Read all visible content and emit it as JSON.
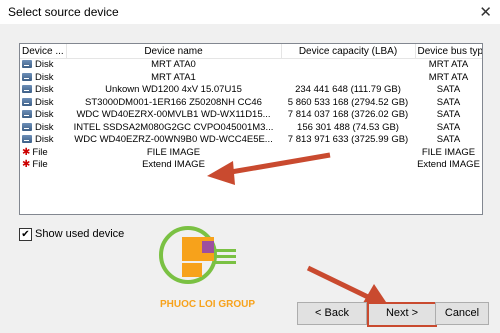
{
  "window": {
    "title": "Select source device",
    "close_glyph": "✕"
  },
  "table": {
    "headers": [
      "Device ...",
      "Device name",
      "Device capacity (LBA)",
      "Device bus type"
    ],
    "rows": [
      {
        "type": "Disk",
        "icon": "disk-icon",
        "name": "MRT ATA0",
        "capacity": "",
        "bus": "MRT ATA"
      },
      {
        "type": "Disk",
        "icon": "disk-icon",
        "name": "MRT ATA1",
        "capacity": "",
        "bus": "MRT ATA"
      },
      {
        "type": "Disk",
        "icon": "disk-icon",
        "name": "Unkown WD1200 4xV 15.07U15",
        "capacity": "234 441 648 (111.79 GB)",
        "bus": "SATA"
      },
      {
        "type": "Disk",
        "icon": "disk-icon",
        "name": "ST3000DM001-1ER166 Z50208NH CC46",
        "capacity": "5 860 533 168 (2794.52 GB)",
        "bus": "SATA"
      },
      {
        "type": "Disk",
        "icon": "disk-icon",
        "name": "WDC WD40EZRX-00MVLB1 WD-WX11D15...",
        "capacity": "7 814 037 168 (3726.02 GB)",
        "bus": "SATA"
      },
      {
        "type": "Disk",
        "icon": "disk-icon",
        "name": "INTEL SSDSA2M080G2GC CVPO045001M3...",
        "capacity": "156 301 488 (74.53 GB)",
        "bus": "SATA"
      },
      {
        "type": "Disk",
        "icon": "disk-icon",
        "name": "WDC WD40EZRZ-00WN9B0 WD-WCC4E5E...",
        "capacity": "7 813 971 633 (3725.99 GB)",
        "bus": "SATA"
      },
      {
        "type": "File",
        "icon": "file-image-icon",
        "name": "FILE IMAGE",
        "capacity": "",
        "bus": "FILE IMAGE"
      },
      {
        "type": "File",
        "icon": "file-image-icon",
        "name": "Extend IMAGE",
        "capacity": "",
        "bus": "Extend IMAGE"
      }
    ]
  },
  "options": {
    "show_used_device": "Show used device",
    "checked": true,
    "check_glyph": "✔"
  },
  "buttons": {
    "back": "< Back",
    "next": "Next >",
    "cancel": "Cancel"
  },
  "logo": {
    "text": "PHUOC LOI GROUP"
  },
  "colors": {
    "accent_arrow": "#c94a2f",
    "selection_border": "#c94a2f"
  }
}
